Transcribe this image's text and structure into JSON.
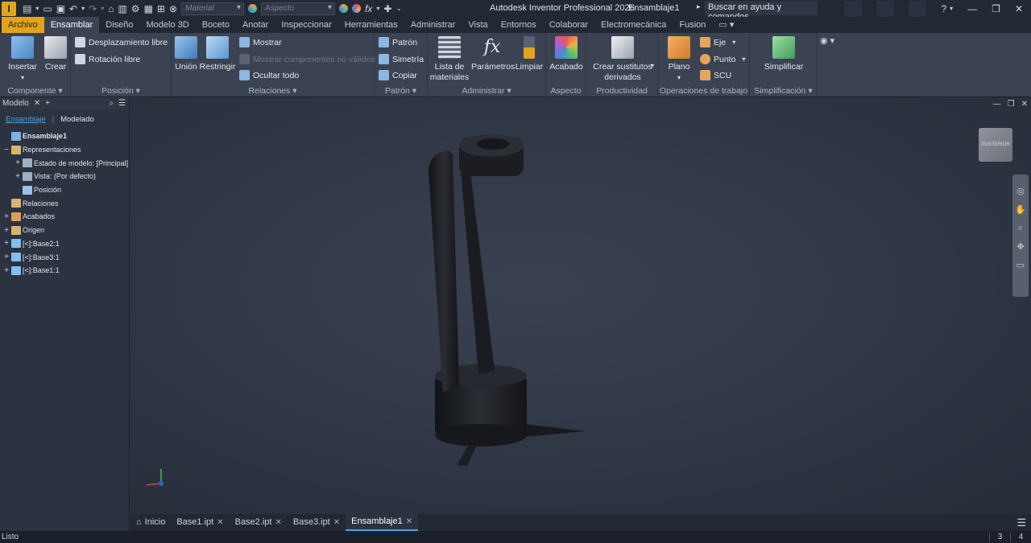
{
  "titlebar": {
    "app_icon": "I",
    "material_placeholder": "Material",
    "aspect_placeholder": "Aspecto",
    "app_title": "Autodesk Inventor Professional 2026",
    "document_title": "Ensamblaje1",
    "help_search": "Buscar en ayuda y comandos..."
  },
  "tabs": [
    "Archivo",
    "Ensamblar",
    "Diseño",
    "Modelo 3D",
    "Boceto",
    "Anotar",
    "Inspeccionar",
    "Herramientas",
    "Administrar",
    "Vista",
    "Entornos",
    "Colaborar",
    "Electromecánica",
    "Fusion"
  ],
  "ribbon": {
    "componente": {
      "label": "Componente",
      "insertar": "Insertar",
      "crear": "Crear"
    },
    "posicion": {
      "label": "Posición",
      "desplazamiento": "Desplazamiento libre",
      "rotacion": "Rotación libre"
    },
    "relaciones": {
      "label": "Relaciones",
      "union": "Unión",
      "restringir": "Restringir",
      "mostrar": "Mostrar",
      "mostrar_no_validos": "Mostrar componentes no válidos",
      "ocultar_todo": "Ocultar todo"
    },
    "patron": {
      "label": "Patrón",
      "patron": "Patrón",
      "simetria": "Simetría",
      "copiar": "Copiar"
    },
    "administrar": {
      "label": "Administrar",
      "lista_1": "Lista de",
      "lista_2": "materiales",
      "parametros": "Parámetros",
      "limpiar": "Limpiar"
    },
    "aspecto": {
      "label": "Aspecto",
      "acabado": "Acabado"
    },
    "productividad": {
      "label": "Productividad",
      "crear_1": "Crear sustitutos",
      "crear_2": "derivados"
    },
    "operaciones": {
      "label": "Operaciones de trabajo",
      "plano": "Plano",
      "eje": "Eje",
      "punto": "Punto",
      "scu": "SCU"
    },
    "simplificacion": {
      "label": "Simplificación",
      "simplificar": "Simplificar"
    }
  },
  "sidebar": {
    "title": "Modelo",
    "subtabs": [
      "Ensamblaje",
      "Modelado"
    ],
    "tree": [
      {
        "label": "Ensamblaje1",
        "expander": "",
        "bold": true,
        "indent": 0,
        "icon": "assembly-icon"
      },
      {
        "label": "Representaciones",
        "expander": "−",
        "indent": 0,
        "icon": "folder-icon"
      },
      {
        "label": "Estado de modelo: [Principal]",
        "expander": "+",
        "indent": 1,
        "icon": "model-state-icon"
      },
      {
        "label": "Vista: (Por defecto)",
        "expander": "+",
        "indent": 1,
        "icon": "view-icon"
      },
      {
        "label": "Posición",
        "expander": "",
        "indent": 1,
        "icon": "position-icon"
      },
      {
        "label": "Relaciones",
        "expander": "",
        "indent": 0,
        "icon": "relations-icon"
      },
      {
        "label": "Acabados",
        "expander": "+",
        "indent": 0,
        "icon": "finishes-icon"
      },
      {
        "label": "Origen",
        "expander": "+",
        "indent": 0,
        "icon": "origin-icon"
      },
      {
        "label": "[<]:Base2:1",
        "expander": "+",
        "indent": 0,
        "icon": "part-icon"
      },
      {
        "label": "[<]:Base3:1",
        "expander": "+",
        "indent": 0,
        "icon": "part-icon"
      },
      {
        "label": "[<]:Base1:1",
        "expander": "+",
        "indent": 0,
        "icon": "part-icon"
      }
    ]
  },
  "viewcube": {
    "face": "POSTERIOR"
  },
  "doctabs": [
    {
      "label": "Inicio",
      "home": true,
      "close": false,
      "active": false
    },
    {
      "label": "Base1.ipt",
      "close": true,
      "active": false
    },
    {
      "label": "Base2.ipt",
      "close": true,
      "active": false
    },
    {
      "label": "Base3.ipt",
      "close": true,
      "active": false
    },
    {
      "label": "Ensamblaje1",
      "close": true,
      "active": true
    }
  ],
  "status": {
    "text": "Listo",
    "count1": "3",
    "count2": "4"
  },
  "colors": {
    "accent": "#e2a41c",
    "selection_blue": "#4aa3e8",
    "background": "#2b3240"
  }
}
